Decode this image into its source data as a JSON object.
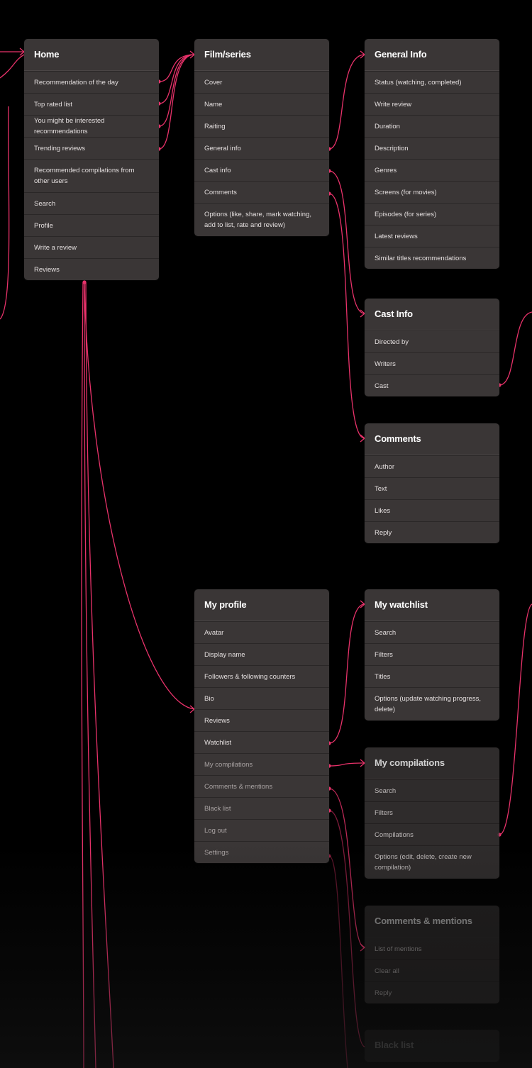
{
  "colors": {
    "link": "#e8326a",
    "card": "#3a3636",
    "background": "#000000"
  },
  "cards": [
    {
      "id": "home",
      "title": "Home",
      "items": [
        "Recommendation of the day",
        "Top rated list",
        "You might be interested recommendations",
        "Trending reviews",
        "Recommended compilations from other users",
        "Search",
        "Profile",
        "Write a review",
        "Reviews"
      ]
    },
    {
      "id": "film-series",
      "title": "Film/series",
      "items": [
        "Cover",
        "Name",
        "Raiting",
        "General info",
        "Cast info",
        "Comments",
        "Options (like, share, mark watching, add to list, rate and review)"
      ]
    },
    {
      "id": "general-info",
      "title": "General Info",
      "items": [
        "Status (watching, completed)",
        "Write review",
        "Duration",
        "Description",
        "Genres",
        "Screens (for movies)",
        "Episodes (for series)",
        "Latest reviews",
        "Similar titles recommendations"
      ]
    },
    {
      "id": "cast-info",
      "title": "Cast Info",
      "items": [
        "Directed by",
        "Writers",
        "Cast"
      ]
    },
    {
      "id": "comments",
      "title": "Comments",
      "items": [
        "Author",
        "Text",
        "Likes",
        "Reply"
      ]
    },
    {
      "id": "my-profile",
      "title": "My profile",
      "items": [
        "Avatar",
        "Display name",
        "Followers & following counters",
        "Bio",
        "Reviews",
        "Watchlist",
        "My compilations",
        "Comments & mentions",
        "Black list",
        "Log out",
        "Settings"
      ]
    },
    {
      "id": "my-watchlist",
      "title": "My watchlist",
      "items": [
        "Search",
        "Filters",
        "Titles",
        "Options (update watching progress, delete)"
      ]
    },
    {
      "id": "my-compilations",
      "title": "My compilations",
      "items": [
        "Search",
        "Filters",
        "Compilations",
        "Options (edit, delete, create new compilation)"
      ]
    },
    {
      "id": "comments-mentions",
      "title": "Comments & mentions",
      "items": [
        "List of mentions",
        "Clear all",
        "Reply"
      ]
    },
    {
      "id": "black-list",
      "title": "Black list",
      "items": []
    }
  ]
}
